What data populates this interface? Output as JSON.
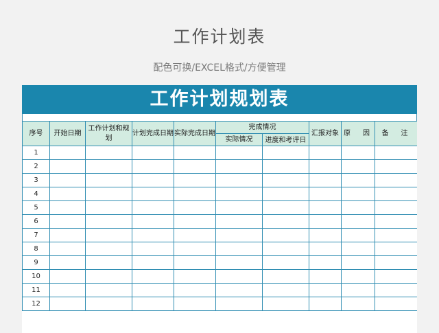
{
  "page": {
    "title": "工作计划表",
    "subtitle": "配色可换/EXCEL格式/方便管理"
  },
  "sheet": {
    "banner": "工作计划规划表",
    "headers": {
      "seq": "序号",
      "start_date": "开始日期",
      "plan": "工作计划和规划",
      "plan_done_date": "计划完成日期",
      "actual_done_date": "实际完成日期",
      "completion": "完成情况",
      "actual_status": "实际情况",
      "progress": "进度和考评日期",
      "report_to": "汇报对象",
      "reason": "原　因",
      "remark": "备　注"
    },
    "rows": [
      "1",
      "2",
      "3",
      "4",
      "5",
      "6",
      "7",
      "8",
      "9",
      "10",
      "11",
      "12"
    ]
  }
}
